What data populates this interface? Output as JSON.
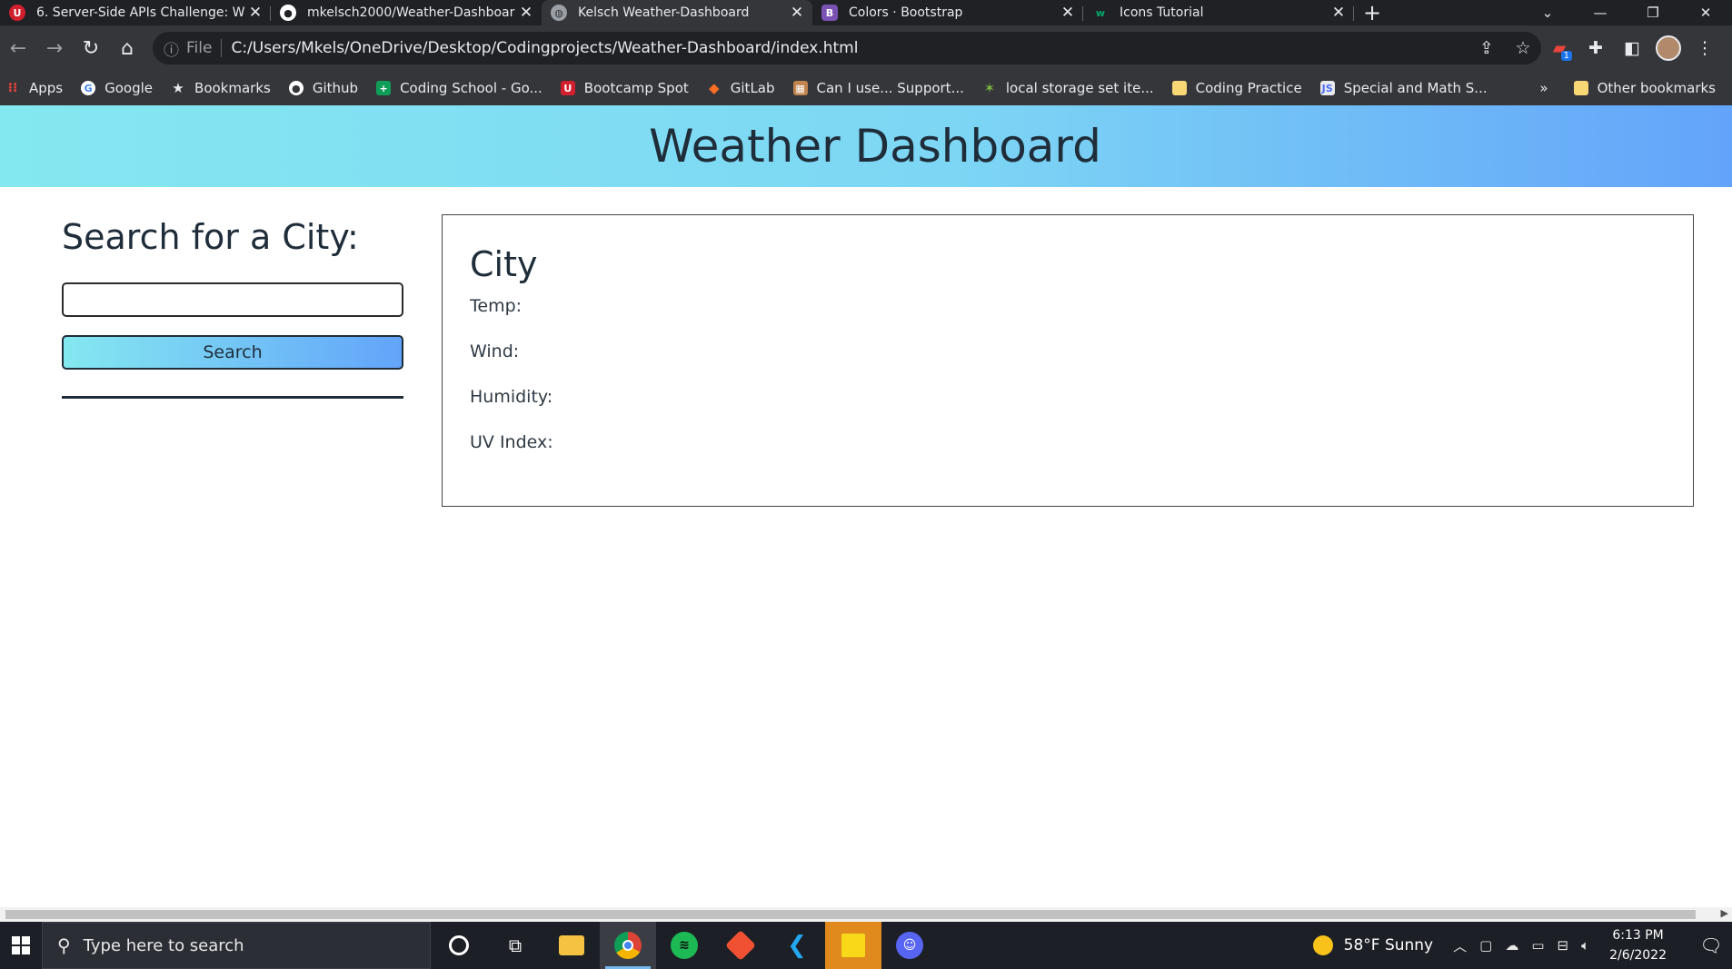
{
  "browser": {
    "tabs": [
      {
        "title": "6. Server-Side APIs Challenge: W",
        "icon": "bootcamp-icon",
        "icon_color": "#d11f2e",
        "active": false
      },
      {
        "title": "mkelsch2000/Weather-Dashboar",
        "icon": "github-icon",
        "icon_color": "#ffffff",
        "active": false
      },
      {
        "title": "Kelsch Weather-Dashboard",
        "icon": "globe-icon",
        "icon_color": "#9aa0a6",
        "active": true
      },
      {
        "title": "Colors · Bootstrap",
        "icon": "bootstrap-icon",
        "icon_color": "#7952b3",
        "active": false
      },
      {
        "title": "Icons Tutorial",
        "icon": "w3schools-icon",
        "icon_color": "#04aa6d",
        "active": false
      }
    ],
    "tab_glyphs": {
      "bootstrap": "B",
      "w3schools": "w"
    },
    "address": {
      "scheme_label": "File",
      "url": "C:/Users/Mkels/OneDrive/Desktop/Codingprojects/Weather-Dashboard/index.html"
    },
    "extension_badge": "1",
    "bookmarks": [
      {
        "label": "Apps",
        "icon": "apps-grid-icon",
        "color": "#e8453c"
      },
      {
        "label": "Google",
        "icon": "google-icon",
        "color": "#ffffff"
      },
      {
        "label": "Bookmarks",
        "icon": "star-icon",
        "color": "#e8eaed"
      },
      {
        "label": "Github",
        "icon": "github-icon",
        "color": "#ffffff"
      },
      {
        "label": "Coding School - Go...",
        "icon": "sheets-icon",
        "color": "#0f9d58"
      },
      {
        "label": "Bootcamp Spot",
        "icon": "bootcamp-icon",
        "color": "#d11f2e"
      },
      {
        "label": "GitLab",
        "icon": "gitlab-icon",
        "color": "#fc6d26"
      },
      {
        "label": "Can I use... Support...",
        "icon": "caniuse-icon",
        "color": "#c1844e"
      },
      {
        "label": "local storage set ite...",
        "icon": "sparkle-icon",
        "color": "#7cb342"
      },
      {
        "label": "Coding Practice",
        "icon": "folder-icon",
        "color": "#f8d775"
      },
      {
        "label": "Special and Math S...",
        "icon": "js-icon",
        "color": "#4c6ef5"
      }
    ],
    "bookmarks_overflow": "»",
    "other_bookmarks": "Other bookmarks"
  },
  "page": {
    "header_title": "Weather Dashboard",
    "search": {
      "heading": "Search for a City:",
      "input_value": "",
      "input_placeholder": "",
      "button_label": "Search"
    },
    "current": {
      "city": "City",
      "temp_label": "Temp:",
      "wind_label": "Wind:",
      "humidity_label": "Humidity:",
      "uv_label": "UV Index:"
    },
    "colors": {
      "gradient_start": "#84e8f0",
      "gradient_end": "#63a4fa",
      "text": "#1f2d3a"
    }
  },
  "taskbar": {
    "search_placeholder": "Type here to search",
    "apps": [
      "cortana-icon",
      "task-view-icon",
      "file-explorer-icon",
      "chrome-icon",
      "spotify-icon",
      "git-icon",
      "vscode-icon",
      "sticky-notes-icon",
      "discord-icon"
    ],
    "weather": "58°F  Sunny",
    "time": "6:13 PM",
    "date": "2/6/2022"
  }
}
